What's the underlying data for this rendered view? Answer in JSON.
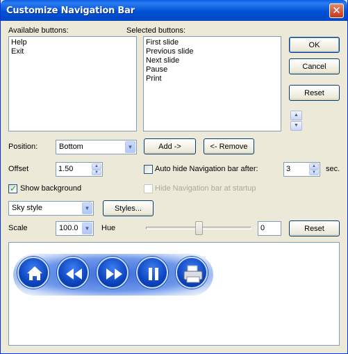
{
  "window": {
    "title": "Customize Navigation Bar"
  },
  "available": {
    "label": "Available buttons:",
    "items": [
      "Help",
      "Exit"
    ]
  },
  "selected": {
    "label": "Selected buttons:",
    "items": [
      "First slide",
      "Previous slide",
      "Next slide",
      "Pause",
      "Print"
    ]
  },
  "buttons": {
    "ok": "OK",
    "cancel": "Cancel",
    "reset": "Reset",
    "add": "Add ->",
    "remove": "<- Remove",
    "styles": "Styles...",
    "reset2": "Reset"
  },
  "position": {
    "label": "Position:",
    "value": "Bottom"
  },
  "offset": {
    "label": "Offset",
    "value": "1.50"
  },
  "autohide": {
    "label": "Auto hide Navigation bar after:",
    "checked": false,
    "value": "3",
    "unit": "sec."
  },
  "show_background": {
    "label": "Show background",
    "checked": true
  },
  "hide_startup": {
    "label": "Hide Navigation bar at startup",
    "checked": false,
    "enabled": false
  },
  "style": {
    "value": "Sky style"
  },
  "scale": {
    "label": "Scale",
    "value": "100.0"
  },
  "hue": {
    "label": "Hue",
    "value": "0",
    "slider_fraction": 0.5
  },
  "preview": {
    "icons": [
      "home-icon",
      "previous-icon",
      "next-icon",
      "pause-icon",
      "print-icon"
    ],
    "accent": "#0d45c0"
  }
}
